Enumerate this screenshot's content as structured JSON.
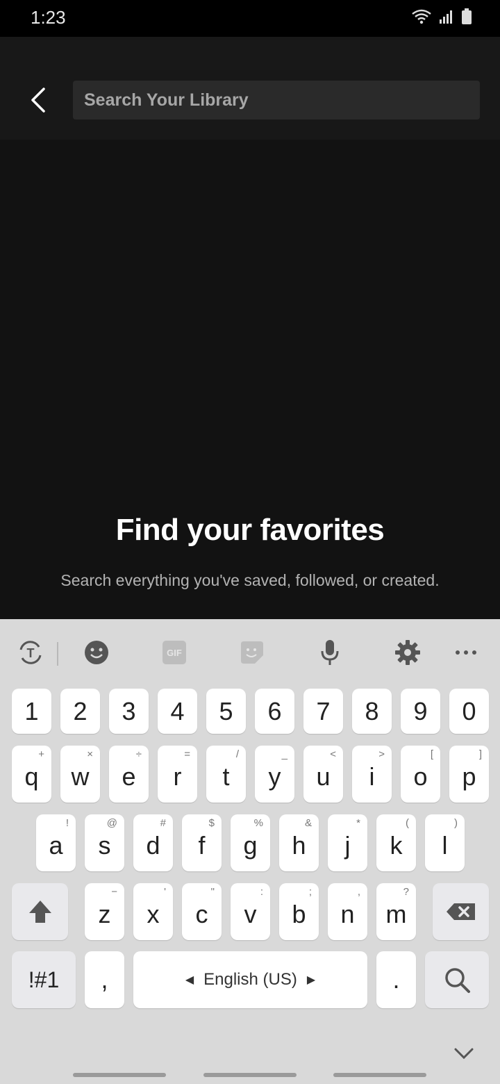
{
  "status": {
    "time": "1:23"
  },
  "search": {
    "placeholder": "Search Your Library",
    "value": ""
  },
  "empty_state": {
    "title": "Find your favorites",
    "subtitle": "Search everything you've saved, followed, or created."
  },
  "keyboard": {
    "toolbar": [
      "text-transform-icon",
      "emoji-icon",
      "gif-icon",
      "sticker-icon",
      "mic-icon",
      "settings-icon",
      "more-icon"
    ],
    "gif_label": "GIF",
    "numbers": [
      "1",
      "2",
      "3",
      "4",
      "5",
      "6",
      "7",
      "8",
      "9",
      "0"
    ],
    "row1": [
      [
        "q",
        "+"
      ],
      [
        "w",
        "×"
      ],
      [
        "e",
        "÷"
      ],
      [
        "r",
        "="
      ],
      [
        "t",
        "/"
      ],
      [
        "y",
        "_"
      ],
      [
        "u",
        "<"
      ],
      [
        "i",
        ">"
      ],
      [
        "o",
        "["
      ],
      [
        "p",
        "]"
      ]
    ],
    "row2": [
      [
        "a",
        "!"
      ],
      [
        "s",
        "@"
      ],
      [
        "d",
        "#"
      ],
      [
        "f",
        "$"
      ],
      [
        "g",
        "%"
      ],
      [
        "h",
        "&"
      ],
      [
        "j",
        "*"
      ],
      [
        "k",
        "("
      ],
      [
        "l",
        ")"
      ]
    ],
    "row3": [
      [
        "z",
        "−"
      ],
      [
        "x",
        "'"
      ],
      [
        "c",
        "\""
      ],
      [
        "v",
        ":"
      ],
      [
        "b",
        ";"
      ],
      [
        "n",
        ","
      ],
      [
        "m",
        "?"
      ]
    ],
    "symbols_label": "!#1",
    "comma_label": ",",
    "space_label": "English (US)",
    "period_label": "."
  },
  "colors": {
    "background": "#121212",
    "header": "#181818",
    "search_bg": "#2a2a2a",
    "keyboard_bg": "#d9d9d9"
  }
}
